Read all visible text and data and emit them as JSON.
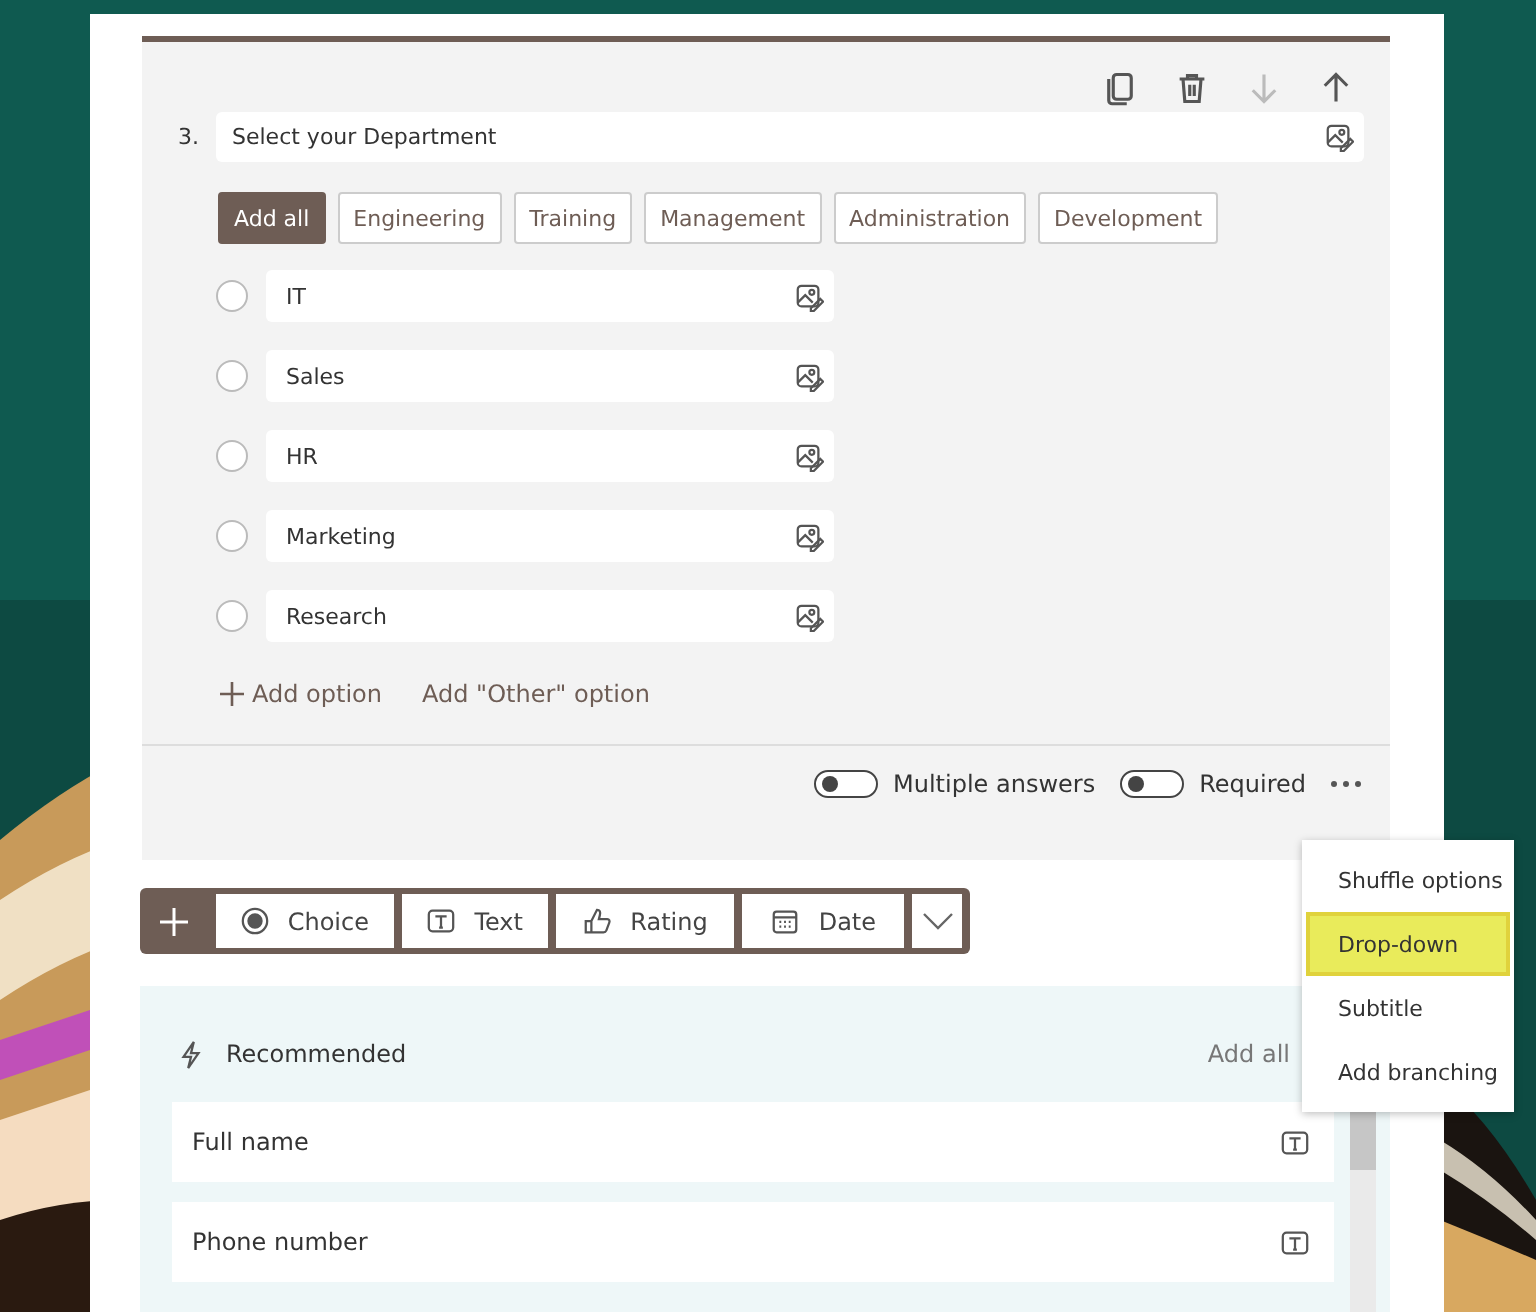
{
  "question": {
    "number": "3.",
    "title": "Select your Department",
    "actions": [
      {
        "kind": "copy",
        "disabled": false
      },
      {
        "kind": "delete",
        "disabled": false
      },
      {
        "kind": "down",
        "disabled": true
      },
      {
        "kind": "up",
        "disabled": false
      }
    ],
    "add_all": "Add all",
    "suggestions": [
      "Engineering",
      "Training",
      "Management",
      "Administration",
      "Development"
    ],
    "options": [
      {
        "label": "IT",
        "checked": false
      },
      {
        "label": "Sales",
        "checked": false
      },
      {
        "label": "HR",
        "checked": false
      },
      {
        "label": "Marketing",
        "checked": false
      },
      {
        "label": "Research",
        "checked": false
      }
    ],
    "add_option": "Add option",
    "add_other": "Add \"Other\" option",
    "toggles": [
      {
        "label": "Multiple answers",
        "on": false
      },
      {
        "label": "Required",
        "on": false
      }
    ]
  },
  "menu": [
    {
      "label": "Shuffle options",
      "selected": false
    },
    {
      "label": "Drop-down",
      "selected": true
    },
    {
      "label": "Subtitle",
      "selected": false
    },
    {
      "label": "Add branching",
      "selected": false
    }
  ],
  "types": [
    {
      "kind": "choice",
      "label": "Choice"
    },
    {
      "kind": "text",
      "label": "Text"
    },
    {
      "kind": "rating",
      "label": "Rating"
    },
    {
      "kind": "date",
      "label": "Date"
    }
  ],
  "recommended": {
    "title": "Recommended",
    "add_all": "Add all",
    "items": [
      {
        "label": "Full name",
        "kind": "text"
      },
      {
        "label": "Phone number",
        "kind": "text"
      }
    ]
  }
}
